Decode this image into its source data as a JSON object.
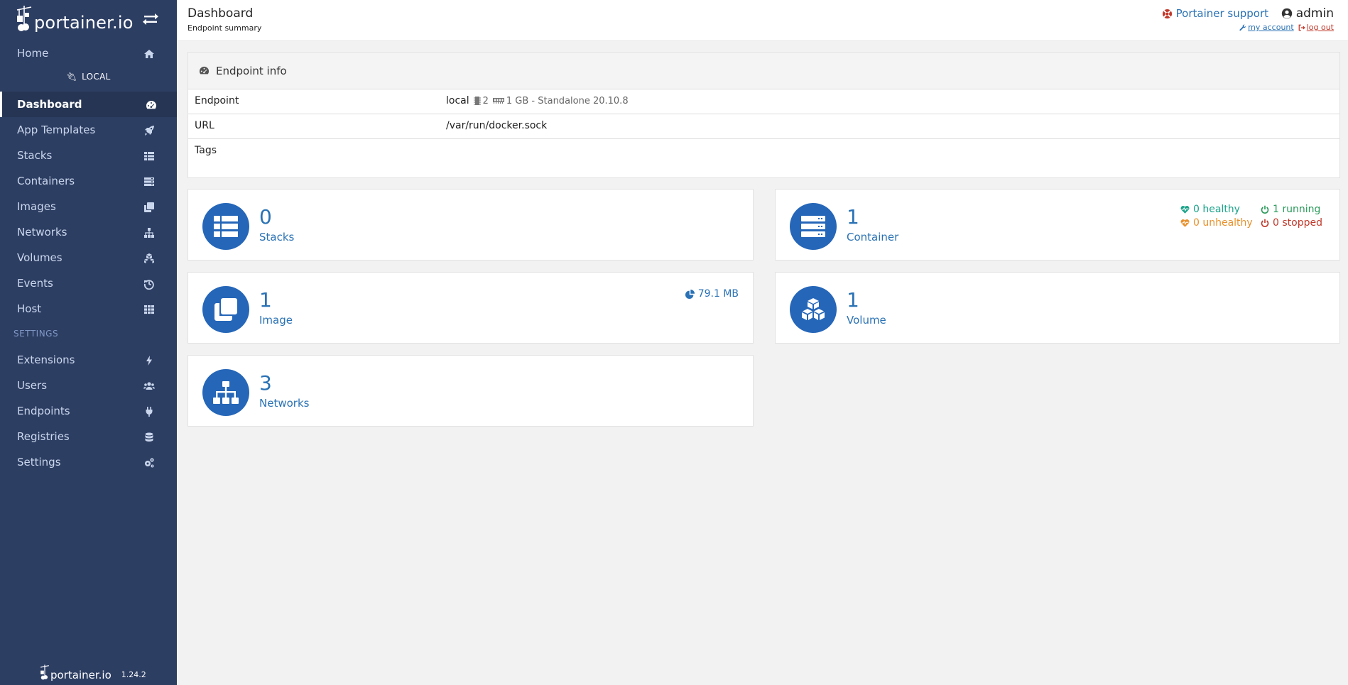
{
  "brand": {
    "name": "portainer.io",
    "version": "1.24.2"
  },
  "sidebar": {
    "home": "Home",
    "endpoint": "LOCAL",
    "items": [
      {
        "label": "Dashboard",
        "icon": "tachometer-icon"
      },
      {
        "label": "App Templates",
        "icon": "rocket-icon"
      },
      {
        "label": "Stacks",
        "icon": "th-list-icon"
      },
      {
        "label": "Containers",
        "icon": "server-icon"
      },
      {
        "label": "Images",
        "icon": "clone-icon"
      },
      {
        "label": "Networks",
        "icon": "sitemap-icon"
      },
      {
        "label": "Volumes",
        "icon": "cubes-icon"
      },
      {
        "label": "Events",
        "icon": "history-icon"
      },
      {
        "label": "Host",
        "icon": "th-icon"
      }
    ],
    "settings_section": "SETTINGS",
    "settings_items": [
      {
        "label": "Extensions",
        "icon": "bolt-icon"
      },
      {
        "label": "Users",
        "icon": "users-icon"
      },
      {
        "label": "Endpoints",
        "icon": "plug-icon"
      },
      {
        "label": "Registries",
        "icon": "database-icon"
      },
      {
        "label": "Settings",
        "icon": "cogs-icon"
      }
    ]
  },
  "header": {
    "title": "Dashboard",
    "subtitle": "Endpoint summary",
    "support": "Portainer support",
    "user": "admin",
    "my_account": "my account",
    "log_out": "log out"
  },
  "endpoint_info": {
    "title": "Endpoint info",
    "rows": {
      "endpoint_key": "Endpoint",
      "endpoint_name": "local",
      "cpu": "2",
      "memory_info": "1 GB - Standalone 20.10.8",
      "url_key": "URL",
      "url_value": "/var/run/docker.sock",
      "tags_key": "Tags"
    }
  },
  "widgets": {
    "stacks": {
      "count": "0",
      "label": "Stacks"
    },
    "containers": {
      "count": "1",
      "label": "Container",
      "healthy": "0 healthy",
      "running": "1 running",
      "unhealthy": "0 unhealthy",
      "stopped": "0 stopped"
    },
    "images": {
      "count": "1",
      "label": "Image",
      "size": "79.1 MB"
    },
    "volumes": {
      "count": "1",
      "label": "Volume"
    },
    "networks": {
      "count": "3",
      "label": "Networks"
    }
  },
  "colors": {
    "sidebar": "#2d3e63",
    "accent": "#2566b8",
    "link": "#2a72b5"
  }
}
